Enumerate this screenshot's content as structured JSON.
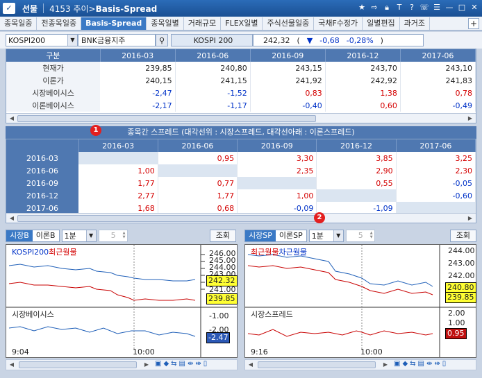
{
  "window": {
    "category": "선물",
    "screen_no": "4153",
    "title_prefix": "추이>",
    "title_main": "Basis-Spread"
  },
  "tabs": [
    "종목일중",
    "전종목일중",
    "Basis-Spread",
    "종목일별",
    "거래규모",
    "FLEX일별",
    "주식선물일중",
    "국채F수정가",
    "일별편집",
    "과거조"
  ],
  "active_tab": 2,
  "toolbar": {
    "code": "KOSPI200",
    "name": "BNK금융지주",
    "index_label": "KOSPI 200",
    "price": "242,32",
    "arrow": "▼",
    "change": "-0,68",
    "pct": "-0,28%",
    "open_paren": "(",
    "close_paren": ")"
  },
  "basis": {
    "header": [
      "구분",
      "2016-03",
      "2016-06",
      "2016-09",
      "2016-12",
      "2017-06"
    ],
    "rows": [
      {
        "label": "현재가",
        "vals": [
          "239,85",
          "240,80",
          "243,15",
          "243,70",
          "243,10"
        ],
        "cls": [
          "",
          "",
          "",
          "",
          ""
        ]
      },
      {
        "label": "이론가",
        "vals": [
          "240,15",
          "241,15",
          "241,92",
          "242,92",
          "241,83"
        ],
        "cls": [
          "",
          "",
          "",
          "",
          ""
        ]
      },
      {
        "label": "시장베이시스",
        "vals": [
          "-2,47",
          "-1,52",
          "0,83",
          "1,38",
          "0,78"
        ],
        "cls": [
          "blue",
          "blue",
          "red",
          "red",
          "red"
        ]
      },
      {
        "label": "이론베이시스",
        "vals": [
          "-2,17",
          "-1,17",
          "-0,40",
          "0,60",
          "-0,49"
        ],
        "cls": [
          "blue",
          "blue",
          "blue",
          "red",
          "blue"
        ]
      }
    ]
  },
  "spread": {
    "title": "종목간 스프레드 (대각선위 : 시장스프레드, 대각선아래 : 이론스프레드)",
    "header": [
      "",
      "2016-03",
      "2016-06",
      "2016-09",
      "2016-12",
      "2017-06"
    ],
    "rows": [
      {
        "label": "2016-03",
        "vals": [
          "",
          "0,95",
          "3,30",
          "3,85",
          "3,25"
        ],
        "cls": [
          "blank",
          "red",
          "red",
          "red",
          "red"
        ]
      },
      {
        "label": "2016-06",
        "vals": [
          "1,00",
          "",
          "2,35",
          "2,90",
          "2,30"
        ],
        "cls": [
          "red",
          "blank",
          "red",
          "red",
          "red"
        ]
      },
      {
        "label": "2016-09",
        "vals": [
          "1,77",
          "0,77",
          "",
          "0,55",
          "-0,05"
        ],
        "cls": [
          "red",
          "red",
          "blank",
          "red",
          "blue"
        ]
      },
      {
        "label": "2016-12",
        "vals": [
          "2,77",
          "1,77",
          "1,00",
          "",
          "-0,60"
        ],
        "cls": [
          "red",
          "red",
          "red",
          "blank",
          "blue"
        ]
      },
      {
        "label": "2017-06",
        "vals": [
          "1,68",
          "0,68",
          "-0,09",
          "-1,09",
          ""
        ],
        "cls": [
          "red",
          "red",
          "blue",
          "blue",
          "blank"
        ]
      }
    ]
  },
  "markers": [
    "1",
    "2"
  ],
  "left_panel": {
    "seg": [
      "시장B",
      "이론B"
    ],
    "interval": "1분",
    "count": "5",
    "query": "조회",
    "legend_a": "KOSPI200",
    "legend_b": "최근월물",
    "legend_bottom": "시장베이시스",
    "y_top": [
      "246.00",
      "245.00",
      "244.00",
      "243.00",
      "242.00",
      "241.00"
    ],
    "badge1": "242.32",
    "badge2": "239.85",
    "y_bottom": [
      "-1.00",
      "-2.00"
    ],
    "badge3": "-2.47",
    "x_labels": [
      "9:04",
      "10:00"
    ],
    "colors": {
      "blue": "#1f5fb8",
      "red": "#c80000",
      "badge_yellow": "#ffff33",
      "badge_blue": "#2b58b5"
    }
  },
  "right_panel": {
    "seg": [
      "시장SP",
      "이론SP"
    ],
    "interval": "1분",
    "count": "5",
    "query": "조회",
    "legend_a": "최근월물",
    "legend_b": "차근월물",
    "legend_bottom": "시장스프레드",
    "y_top": [
      "244.00",
      "243.00",
      "242.00",
      "241.00"
    ],
    "badge1": "240.80",
    "badge2": "239.85",
    "y_bottom": [
      "2.00",
      "1.00"
    ],
    "badge3": "0.95",
    "x_labels": [
      "9:16",
      "10:00"
    ]
  }
}
